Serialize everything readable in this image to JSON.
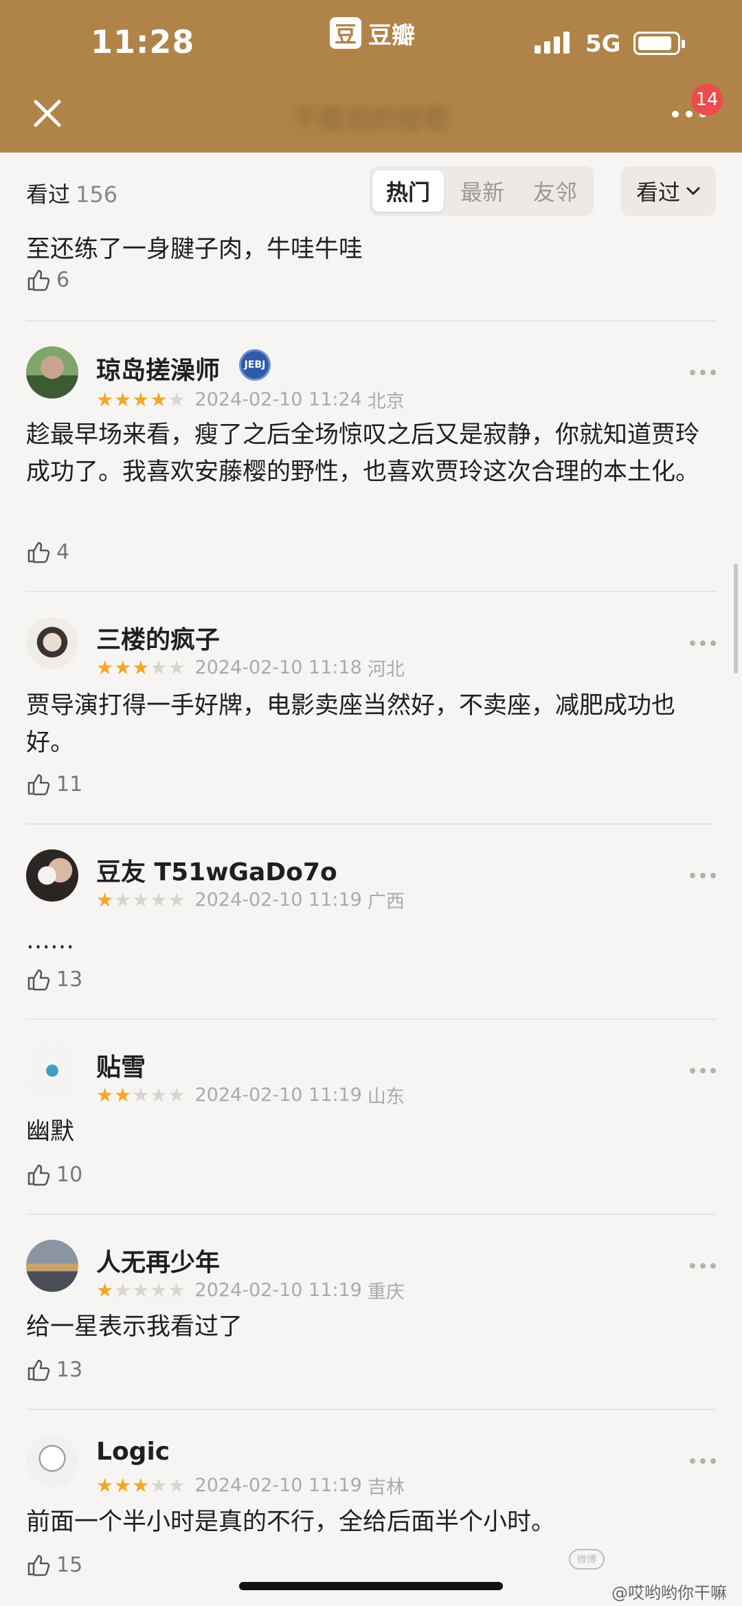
{
  "status_bar": {
    "time": "11:28",
    "app_name": "豆瓣",
    "app_logo_char": "豆",
    "network": "5G"
  },
  "header": {
    "title": "不能说的秘密",
    "notification_count": "14"
  },
  "filter": {
    "count_label": "看过",
    "count": "156",
    "tabs": [
      {
        "label": "热门",
        "active": true
      },
      {
        "label": "最新",
        "active": false
      },
      {
        "label": "友邻",
        "active": false
      }
    ],
    "sort_label": "看过"
  },
  "partial": {
    "text": "至还练了一身腱子肉，牛哇牛哇",
    "likes": "6"
  },
  "reviews": [
    {
      "name": "琼岛搓澡师",
      "rating": 4,
      "date": "2024-02-10 11:24",
      "location": "北京",
      "text": "趁最早场来看，瘦了之后全场惊叹之后又是寂静，你就知道贾玲成功了。我喜欢安藤樱的野性，也喜欢贾玲这次合理的本土化。",
      "likes": "4"
    },
    {
      "name": "三楼的疯子",
      "rating": 3,
      "date": "2024-02-10 11:18",
      "location": "河北",
      "text": "贾导演打得一手好牌，电影卖座当然好，不卖座，减肥成功也好。",
      "likes": "11"
    },
    {
      "name": "豆友 T51wGaDo7o",
      "rating": 1,
      "date": "2024-02-10 11:19",
      "location": "广西",
      "text": "……",
      "likes": "13"
    },
    {
      "name": "贴雪",
      "rating": 2,
      "date": "2024-02-10 11:19",
      "location": "山东",
      "text": "幽默",
      "likes": "10"
    },
    {
      "name": "人无再少年",
      "rating": 1,
      "date": "2024-02-10 11:19",
      "location": "重庆",
      "text": "给一星表示我看过了",
      "likes": "13"
    },
    {
      "name": "Logic",
      "rating": 3,
      "date": "2024-02-10 11:19",
      "location": "吉林",
      "text": "前面一个半小时是真的不行，全给后面半个小时。",
      "likes": "15"
    }
  ],
  "watermark": {
    "text": "@哎哟哟你干嘛",
    "logo_text": "微博"
  },
  "colors": {
    "header_bg": "#b08348",
    "star": "#f5a623",
    "badge": "#ee4b4b"
  }
}
